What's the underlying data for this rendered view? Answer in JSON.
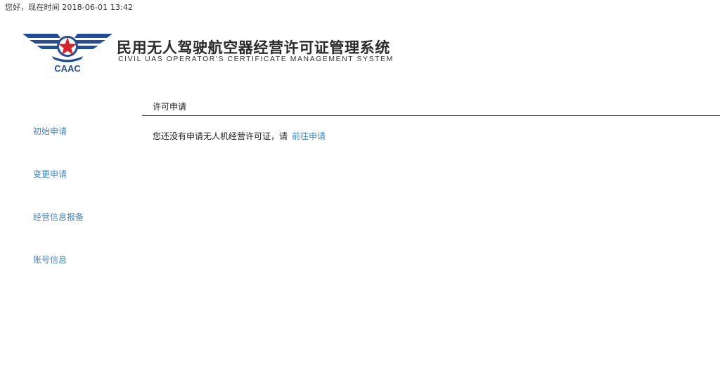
{
  "header": {
    "greeting": "您好，现在时间 2018-06-01 13:42",
    "logo_text": "CAAC",
    "title_cn": "民用无人驾驶航空器经营许可证管理系统",
    "title_en": "CIVIL UAS OPERATOR'S CERTIFICATE MANAGEMENT SYSTEM"
  },
  "sidebar": {
    "items": [
      {
        "label": "初始申请"
      },
      {
        "label": "变更申请"
      },
      {
        "label": "经营信息报备"
      },
      {
        "label": "账号信息"
      }
    ]
  },
  "main": {
    "section_title": "许可申请",
    "message": "您还没有申请无人机经营许可证，请",
    "apply_link": "前往申请"
  },
  "colors": {
    "link": "#3f86c8",
    "logo_blue": "#1f4e9c",
    "logo_red": "#d7232a"
  }
}
